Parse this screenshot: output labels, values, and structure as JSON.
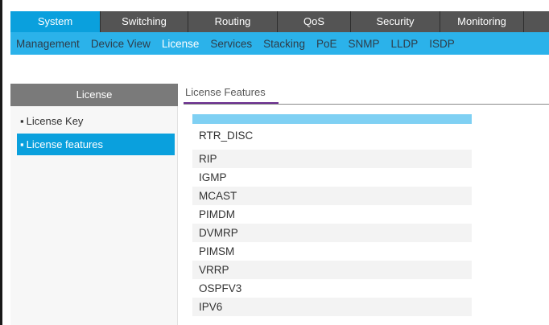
{
  "top_nav": {
    "tabs": [
      {
        "label": "System",
        "active": true
      },
      {
        "label": "Switching",
        "active": false
      },
      {
        "label": "Routing",
        "active": false
      },
      {
        "label": "QoS",
        "active": false
      },
      {
        "label": "Security",
        "active": false
      },
      {
        "label": "Monitoring",
        "active": false
      }
    ]
  },
  "sub_nav": {
    "items": [
      {
        "label": "Management",
        "active": false
      },
      {
        "label": "Device View",
        "active": false
      },
      {
        "label": "License",
        "active": true
      },
      {
        "label": "Services",
        "active": false
      },
      {
        "label": "Stacking",
        "active": false
      },
      {
        "label": "PoE",
        "active": false
      },
      {
        "label": "SNMP",
        "active": false
      },
      {
        "label": "LLDP",
        "active": false
      },
      {
        "label": "ISDP",
        "active": false
      }
    ]
  },
  "sidebar": {
    "title": "License",
    "bullet": "▪",
    "items": [
      {
        "label": "License Key",
        "selected": false
      },
      {
        "label": "License features",
        "selected": true
      }
    ]
  },
  "content": {
    "title": "License Features",
    "features": [
      "RTR_DISC",
      "RIP",
      "IGMP",
      "MCAST",
      "PIMDM",
      "DVMRP",
      "PIMSM",
      "VRRP",
      "OSPFV3",
      "IPV6"
    ]
  },
  "colors": {
    "active_tab": "#0aa0dd",
    "subnav_bg": "#2bb2ea",
    "title_underline": "#6a2d8f",
    "table_header": "#7fd0f3"
  }
}
